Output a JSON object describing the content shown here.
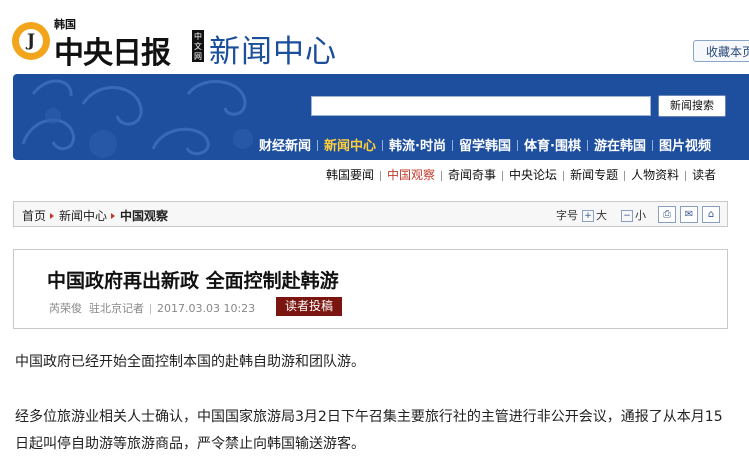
{
  "header": {
    "logo_korea": "韩国",
    "logo_main": "中央日报",
    "logo_cn_tag": "中文网",
    "logo_letter": "J",
    "section_title": "新闻中心",
    "bookmark_label": "收藏本页"
  },
  "search": {
    "placeholder": "",
    "button_label": "新闻搜索"
  },
  "nav": {
    "items": [
      "财经新闻",
      "新闻中心",
      "韩流·时尚",
      "留学韩国",
      "体育·围棋",
      "游在韩国",
      "图片视频"
    ],
    "active_index": 1
  },
  "subnav": {
    "items": [
      "韩国要闻",
      "中国观察",
      "奇闻奇事",
      "中央论坛",
      "新闻专题",
      "人物资料",
      "读者"
    ],
    "active_index": 1
  },
  "breadcrumb": {
    "items": [
      "首页",
      "新闻中心",
      "中国观察"
    ],
    "font_label": "字号",
    "font_large": "大",
    "font_small": "小"
  },
  "article": {
    "title": "中国政府再出新政  全面控制赴韩游",
    "author": "芮荣俊",
    "author_role": "驻北京记者",
    "datetime": "2017.03.03  10:23",
    "reader_button": "读者投稿",
    "paragraphs": [
      "中国政府已经开始全面控制本国的赴韩自助游和团队游。",
      "经多位旅游业相关人士确认，中国国家旅游局3月2日下午召集主要旅行社的主管进行非公开会议，通报了从本月15日起叫停自助游等旅游商品，严令禁止向韩国输送游客。"
    ]
  },
  "colors": {
    "banner_blue": "#1d4f9e",
    "accent_yellow": "#ffce3d",
    "accent_red": "#c0392b",
    "reader_button_bg": "#7a1510",
    "logo_orange": "#f2a51a"
  }
}
